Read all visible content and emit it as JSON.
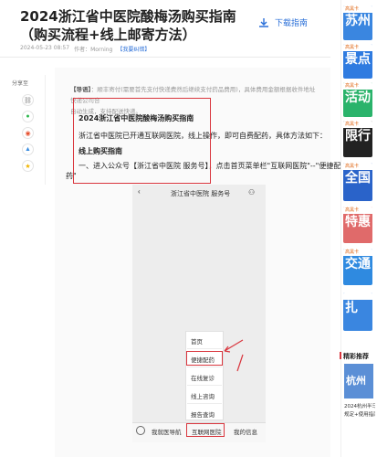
{
  "article": {
    "title": "2024浙江省中医院酸梅汤购买指南（购买流程+线上邮寄方法）",
    "date": "2024-05-23 08:57",
    "author_label": "作者：Morning",
    "tag": "【我要纠错】",
    "download_label": "下载指南"
  },
  "share": {
    "label": "分享至",
    "icons": [
      "link-icon",
      "wechat-icon",
      "weibo-icon",
      "qq-icon",
      "qzone-icon"
    ]
  },
  "content": {
    "notice_label": "【导语】",
    "notice_text": "：顺丰寄付(需要首先支付快递费然后继续支付药品费用)，具体费用金额根据收件地址快递公司合",
    "notice_line2": "自动生成，支持配送快递。",
    "heading": "2024浙江省中医院酸梅汤购买指南",
    "intro": "浙江省中医院已开通互联网医院，线上操作，即可自费配药，具体方法如下：",
    "subheading": "线上购买指南",
    "step1": "一、进入公众号【浙江省中医院 服务号】，点击首页菜单栏\"互联网医院\"--\"便捷配",
    "step1_cont": "药\""
  },
  "phone": {
    "back": "‹",
    "title": "浙江省中医院 服务号",
    "user_icon": "user-icon",
    "menu_items": [
      "首页",
      "便捷配药",
      "在线复诊",
      "线上咨询",
      "报告查询"
    ],
    "tabs": [
      "我就医导航",
      "互联网医院",
      "我的信息"
    ]
  },
  "sidebar_right": {
    "ads": [
      {
        "tag": "高黑卡",
        "text": "苏州",
        "color": "#3a86e0"
      },
      {
        "tag": "高黑卡",
        "text": "景点",
        "color": "#2f7be0"
      },
      {
        "tag": "高黑卡",
        "text": "活动",
        "color": "#2ab36b"
      },
      {
        "tag": "高黑卡",
        "text": "限行",
        "color": "#222222"
      },
      {
        "tag": "高黑卡",
        "text": "全国",
        "color": "#2a63c9"
      },
      {
        "tag": "高黑卡",
        "text": "特惠",
        "color": "#e06a6a"
      },
      {
        "tag": "高黑卡",
        "text": "交通",
        "color": "#2f8ae0"
      },
      {
        "tag": "",
        "text": "扎",
        "color": "#3a86e0"
      }
    ],
    "recommend_title": "精彩推荐",
    "recommend_thumb": "杭州",
    "recommend_text1": "2024杭州半马",
    "recommend_text2": "规定+使用指南"
  }
}
